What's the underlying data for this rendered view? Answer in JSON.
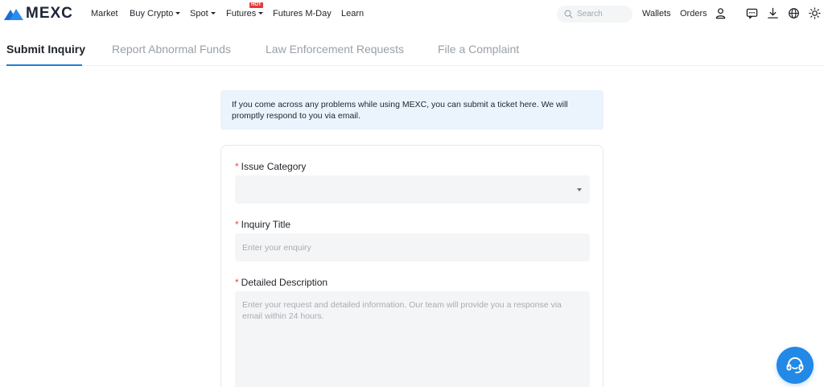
{
  "brand": {
    "name": "MEXC"
  },
  "nav": {
    "market": "Market",
    "buy_crypto": "Buy Crypto",
    "spot": "Spot",
    "futures": "Futures",
    "hot_badge": "HOT",
    "futures_mday": "Futures M-Day",
    "learn": "Learn",
    "wallets": "Wallets",
    "orders": "Orders"
  },
  "search": {
    "placeholder": "Search",
    "value": ""
  },
  "tabs": [
    {
      "label": "Submit Inquiry",
      "active": true
    },
    {
      "label": "Report Abnormal Funds",
      "active": false
    },
    {
      "label": "Law Enforcement Requests",
      "active": false
    },
    {
      "label": "File a Complaint",
      "active": false
    }
  ],
  "banner": {
    "text": "If you come across any problems while using MEXC, you can submit a ticket here. We will promptly respond to you via email."
  },
  "form": {
    "required_mark": "*",
    "issue_category": {
      "label": "Issue Category",
      "value": ""
    },
    "inquiry_title": {
      "label": "Inquiry Title",
      "placeholder": "Enter your enquiry",
      "value": ""
    },
    "description": {
      "label": "Detailed Description",
      "placeholder": "Enter your request and detailed information. Our team will provide you a response via email within 24 hours.",
      "value": ""
    }
  },
  "icons": [
    "search-icon",
    "user-icon",
    "chat-icon",
    "download-icon",
    "globe-icon",
    "theme-sun-icon",
    "support-headset-icon"
  ],
  "colors": {
    "accent": "#1e7fd6",
    "brand_blue": "#2289e6",
    "banner_bg": "#ebf4fc",
    "required": "#e24a4a",
    "hot_badge": "#e23b3b"
  }
}
